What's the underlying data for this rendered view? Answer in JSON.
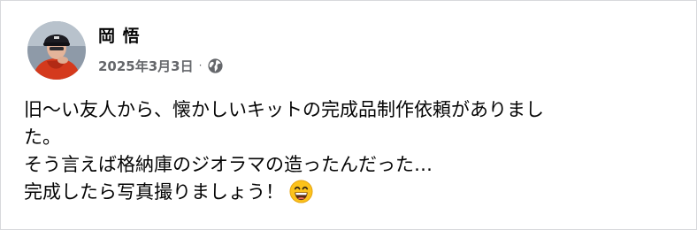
{
  "post": {
    "author": {
      "name": "岡 悟",
      "avatar_icon": "profile-photo"
    },
    "date": "2025年3月3日",
    "separator": "·",
    "audience_icon": "globe-icon",
    "text": {
      "line1": "旧〜い友人から、懐かしいキットの完成品制作依頼がありまし",
      "line2": "た。",
      "line3": "そう言えば格納庫のジオラマの造ったんだった…",
      "line4": "完成したら写真撮りましょう！",
      "emoji_icon": "grinning-smiling-eyes-emoji"
    },
    "colors": {
      "text": "#050505",
      "secondary": "#65676b",
      "border": "#d7d9dc"
    }
  }
}
